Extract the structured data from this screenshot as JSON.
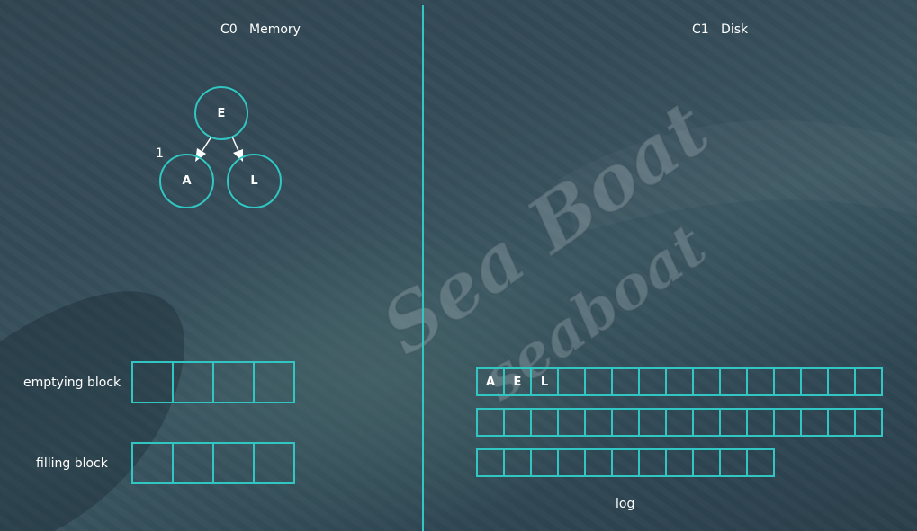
{
  "memory": {
    "title": "C0   Memory",
    "tree": {
      "root": "E",
      "left": "A",
      "right": "L",
      "edge_label": "1"
    },
    "emptying_label": "emptying block",
    "filling_label": "filling block",
    "emptying_cells": [
      "",
      "",
      "",
      ""
    ],
    "filling_cells": [
      "",
      "",
      "",
      ""
    ]
  },
  "disk": {
    "title": "C1   Disk",
    "log_rows": [
      [
        "A",
        "E",
        "L",
        "",
        "",
        "",
        "",
        "",
        "",
        "",
        "",
        "",
        "",
        "",
        ""
      ],
      [
        "",
        "",
        "",
        "",
        "",
        "",
        "",
        "",
        "",
        "",
        "",
        "",
        "",
        "",
        ""
      ],
      [
        "",
        "",
        "",
        "",
        "",
        "",
        "",
        "",
        "",
        "",
        ""
      ]
    ],
    "log_label": "log"
  },
  "watermark": [
    "Sea Boat",
    "seaboat"
  ],
  "colors": {
    "accent": "#31c6c2",
    "text": "#ffffff"
  }
}
